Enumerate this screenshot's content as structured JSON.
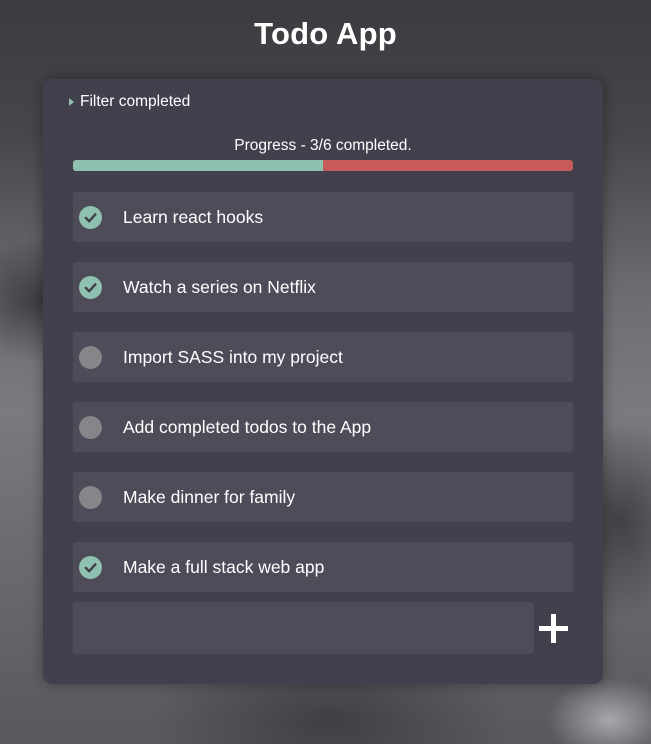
{
  "app": {
    "title": "Todo App"
  },
  "filter": {
    "label": "Filter completed"
  },
  "progress": {
    "label": "Progress - 3/6 completed.",
    "completed": 3,
    "total": 6
  },
  "todos": [
    {
      "text": "Learn react hooks",
      "completed": true
    },
    {
      "text": "Watch a series on Netflix",
      "completed": true
    },
    {
      "text": "Import SASS into my project",
      "completed": false
    },
    {
      "text": "Add completed todos to the App",
      "completed": false
    },
    {
      "text": "Make dinner for family",
      "completed": false
    },
    {
      "text": "Make a full stack web app",
      "completed": true
    }
  ],
  "new_todo": {
    "value": "",
    "placeholder": ""
  },
  "colors": {
    "accent": "#8ec1af",
    "remaining": "#c65b59",
    "card": "#41404c",
    "item": "#4e4c58",
    "unchecked": "#85858a"
  }
}
